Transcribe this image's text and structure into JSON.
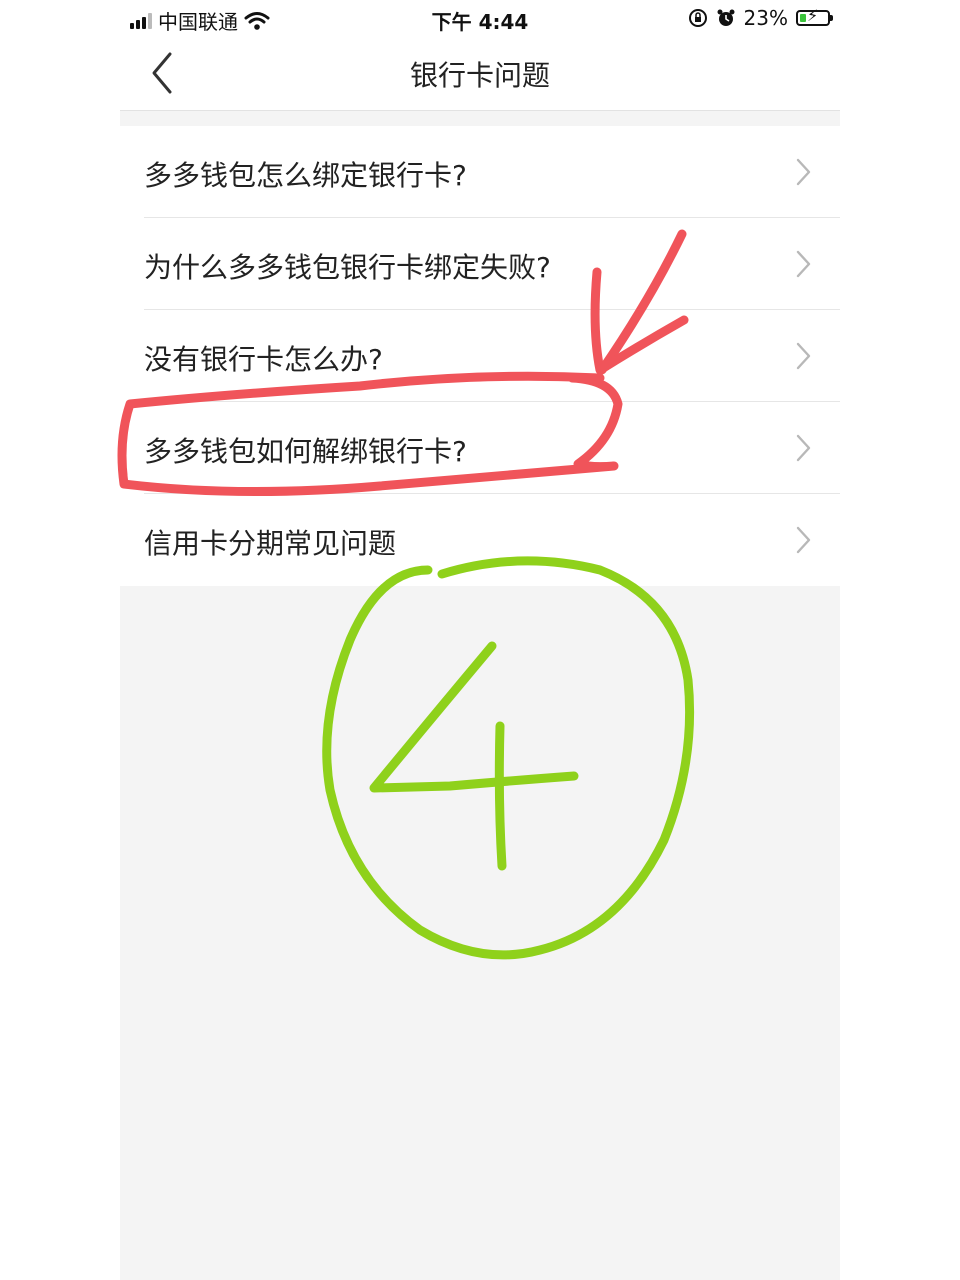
{
  "status_bar": {
    "carrier": "中国联通",
    "time": "下午 4:44",
    "battery": "23%",
    "battery_level": 0.23,
    "icons": [
      "signal-icon",
      "wifi-icon",
      "orientation-lock-icon",
      "alarm-icon",
      "battery-icon"
    ]
  },
  "nav": {
    "title": "银行卡问题",
    "back_icon": "chevron-left-icon"
  },
  "list": {
    "items": [
      {
        "label": "多多钱包怎么绑定银行卡?"
      },
      {
        "label": "为什么多多钱包银行卡绑定失败?"
      },
      {
        "label": "没有银行卡怎么办?"
      },
      {
        "label": "多多钱包如何解绑银行卡?"
      },
      {
        "label": "信用卡分期常见问题"
      }
    ]
  },
  "annotations": {
    "red_color": "#f0545a",
    "green_color": "#8fd11b",
    "circled_number": "4",
    "highlighted_item_index": 3
  }
}
